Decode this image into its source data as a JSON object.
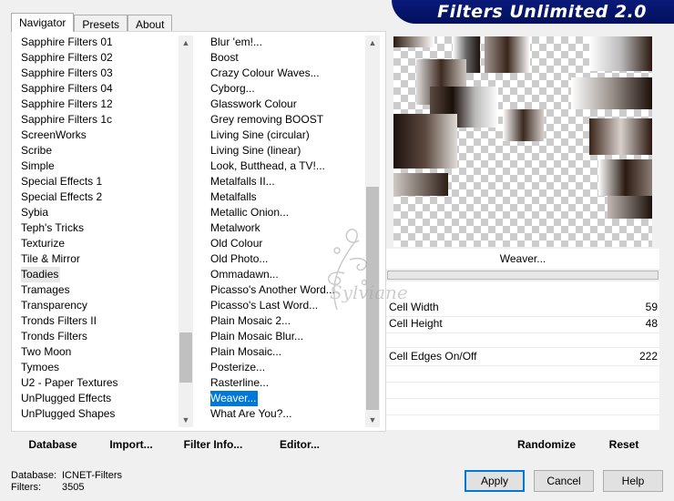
{
  "tabs": [
    "Navigator",
    "Presets",
    "About"
  ],
  "banner_title": "Filters Unlimited 2.0",
  "categories": [
    "Sapphire Filters 01",
    "Sapphire Filters 02",
    "Sapphire Filters 03",
    "Sapphire Filters 04",
    "Sapphire Filters 12",
    "Sapphire Filters 1c",
    "ScreenWorks",
    "Scribe",
    "Simple",
    "Special Effects 1",
    "Special Effects 2",
    "Sybia",
    "Teph's Tricks",
    "Texturize",
    "Tile & Mirror",
    "Toadies",
    "Tramages",
    "Transparency",
    "Tronds Filters II",
    "Tronds Filters",
    "Two Moon",
    "Tymoes",
    "U2 - Paper Textures",
    "UnPlugged Effects",
    "UnPlugged Shapes"
  ],
  "selected_category": "Toadies",
  "filters": [
    "Blur 'em!...",
    "Boost",
    "Crazy Colour Waves...",
    "Cyborg...",
    "Glasswork Colour",
    "Grey removing BOOST",
    "Living Sine (circular)",
    "Living Sine (linear)",
    "Look, Butthead, a TV!...",
    "Metalfalls II...",
    "Metalfalls",
    "Metallic Onion...",
    "Metalwork",
    "Old Colour",
    "Old Photo...",
    "Ommadawn...",
    "Picasso's Another Word...",
    "Picasso's Last Word...",
    "Plain Mosaic 2...",
    "Plain Mosaic Blur...",
    "Plain Mosaic...",
    "Posterize...",
    "Rasterline...",
    "Weaver...",
    "What Are You?..."
  ],
  "selected_filter": "Weaver...",
  "toolbar": {
    "database": "Database",
    "import": "Import...",
    "filter_info": "Filter Info...",
    "editor": "Editor..."
  },
  "preview_filter_name": "Weaver...",
  "params": [
    {
      "label": "Cell Width",
      "value": "59"
    },
    {
      "label": "Cell Height",
      "value": "48"
    },
    {
      "label": "Cell Edges On/Off",
      "value": "222"
    }
  ],
  "randomize": "Randomize",
  "reset": "Reset",
  "footer": {
    "database_label": "Database:",
    "database_value": "ICNET-Filters",
    "filters_label": "Filters:",
    "filters_value": "3505"
  },
  "buttons": {
    "apply": "Apply",
    "cancel": "Cancel",
    "help": "Help"
  },
  "watermark_text": "Sylviane"
}
